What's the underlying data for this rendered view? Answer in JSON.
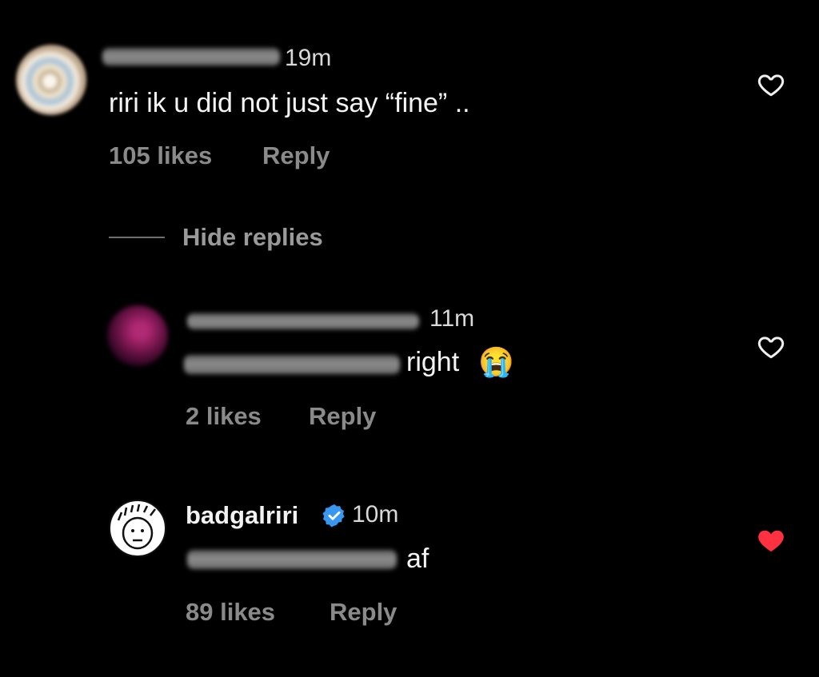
{
  "comments": [
    {
      "time": "19m",
      "text": "riri ik u did not just say “fine” ..",
      "likes": "105 likes",
      "reply_label": "Reply",
      "liked": false
    },
    {
      "time": "11m",
      "text": "right",
      "emoji": "😭",
      "likes": "2 likes",
      "reply_label": "Reply",
      "liked": false
    },
    {
      "username": "badgalriri",
      "verified": true,
      "time": "10m",
      "text": "af",
      "likes": "89 likes",
      "reply_label": "Reply",
      "liked": true
    }
  ],
  "replies_toggle": "Hide replies",
  "colors": {
    "background": "#000000",
    "liked_heart": "#ff3040",
    "verified_badge": "#3897f0"
  },
  "icons": {
    "like": "heart-outline-icon",
    "liked": "heart-filled-icon",
    "verified": "verified-badge-icon"
  }
}
